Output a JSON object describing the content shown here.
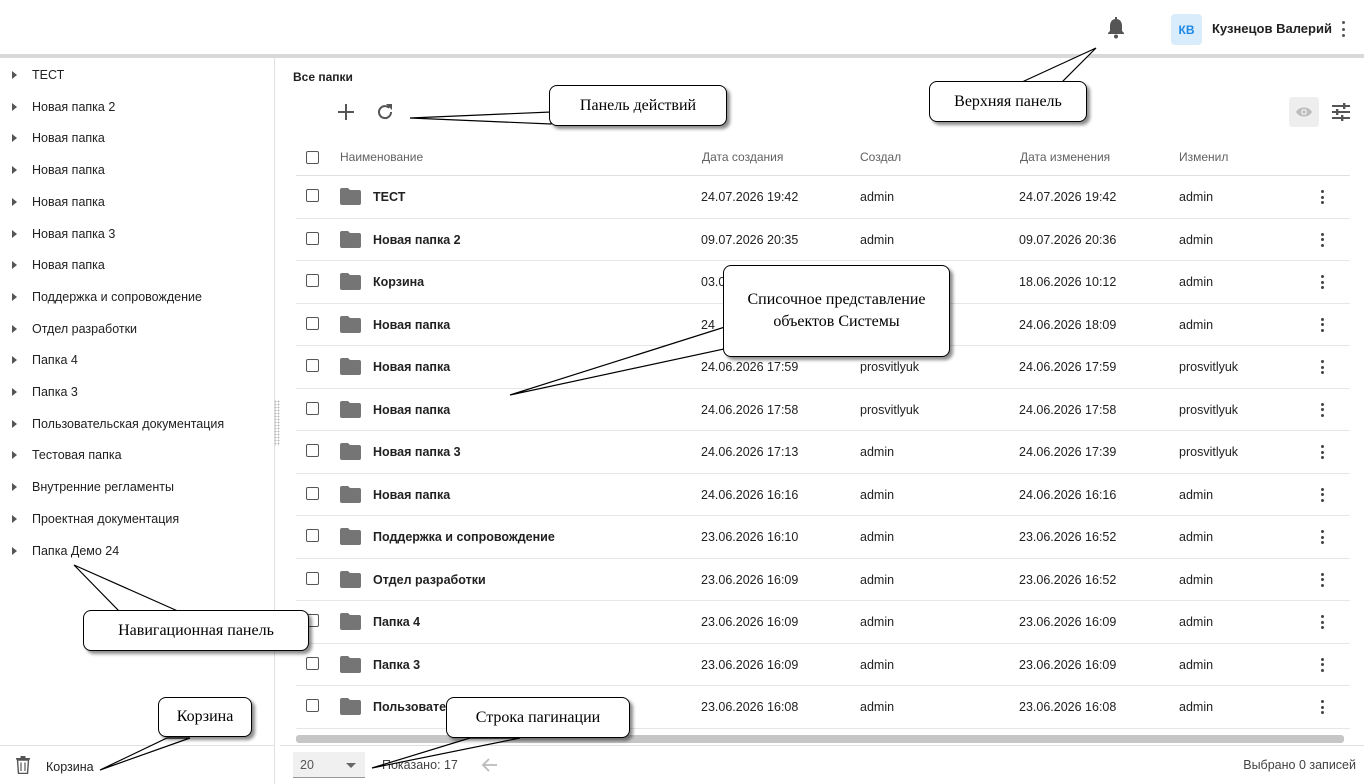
{
  "header": {
    "avatar_initials": "КВ",
    "user_name": "Кузнецов Валерий"
  },
  "sidebar": {
    "items": [
      {
        "label": "ТЕСТ"
      },
      {
        "label": "Новая папка 2"
      },
      {
        "label": "Новая папка"
      },
      {
        "label": "Новая папка"
      },
      {
        "label": "Новая папка"
      },
      {
        "label": "Новая папка 3"
      },
      {
        "label": "Новая папка"
      },
      {
        "label": "Поддержка и сопровождение"
      },
      {
        "label": "Отдел разработки"
      },
      {
        "label": "Папка 4"
      },
      {
        "label": "Папка 3"
      },
      {
        "label": "Пользовательская документация"
      },
      {
        "label": "Тестовая папка"
      },
      {
        "label": "Внутренние регламенты"
      },
      {
        "label": "Проектная документация"
      },
      {
        "label": "Папка Демо 24"
      }
    ],
    "trash_label": "Корзина"
  },
  "main": {
    "title": "Все папки",
    "columns": {
      "name": "Наименование",
      "created": "Дата создания",
      "created_by": "Создал",
      "modified": "Дата изменения",
      "modified_by": "Изменил"
    },
    "rows": [
      {
        "name": "ТЕСТ",
        "created": "24.07.2026 19:42",
        "created_by": "admin",
        "modified": "24.07.2026 19:42",
        "modified_by": "admin"
      },
      {
        "name": "Новая папка 2",
        "created": "09.07.2026 20:35",
        "created_by": "admin",
        "modified": "09.07.2026 20:36",
        "modified_by": "admin"
      },
      {
        "name": "Корзина",
        "created": "03.0",
        "created_by": "",
        "modified": "18.06.2026 10:12",
        "modified_by": "admin"
      },
      {
        "name": "Новая папка",
        "created": "24",
        "created_by": "",
        "modified": "24.06.2026 18:09",
        "modified_by": "admin"
      },
      {
        "name": "Новая папка",
        "created": "24.06.2026 17:59",
        "created_by": "prosvitlyuk",
        "modified": "24.06.2026 17:59",
        "modified_by": "prosvitlyuk"
      },
      {
        "name": "Новая папка",
        "created": "24.06.2026 17:58",
        "created_by": "prosvitlyuk",
        "modified": "24.06.2026 17:58",
        "modified_by": "prosvitlyuk"
      },
      {
        "name": "Новая папка 3",
        "created": "24.06.2026 17:13",
        "created_by": "admin",
        "modified": "24.06.2026 17:39",
        "modified_by": "prosvitlyuk"
      },
      {
        "name": "Новая папка",
        "created": "24.06.2026 16:16",
        "created_by": "admin",
        "modified": "24.06.2026 16:16",
        "modified_by": "admin"
      },
      {
        "name": "Поддержка и сопровождение",
        "created": "23.06.2026 16:10",
        "created_by": "admin",
        "modified": "23.06.2026 16:52",
        "modified_by": "admin"
      },
      {
        "name": "Отдел разработки",
        "created": "23.06.2026 16:09",
        "created_by": "admin",
        "modified": "23.06.2026 16:52",
        "modified_by": "admin"
      },
      {
        "name": "Папка 4",
        "created": "23.06.2026 16:09",
        "created_by": "admin",
        "modified": "23.06.2026 16:09",
        "modified_by": "admin"
      },
      {
        "name": "Папка 3",
        "created": "23.06.2026 16:09",
        "created_by": "admin",
        "modified": "23.06.2026 16:09",
        "modified_by": "admin"
      },
      {
        "name": "Пользовател",
        "created": "23.06.2026 16:08",
        "created_by": "admin",
        "modified": "23.06.2026 16:08",
        "modified_by": "admin"
      }
    ]
  },
  "footer": {
    "page_size": "20",
    "shown": "Показано: 17",
    "selected": "Выбрано 0 записей"
  },
  "callouts": {
    "top_panel": "Верхняя панель",
    "action_panel": "Панель действий",
    "list_view": "Списочное представление объектов Системы",
    "nav_panel": "Навигационная панель",
    "trash": "Корзина",
    "pagination": "Строка пагинации"
  },
  "icons": {
    "bell": "bell-icon",
    "add": "plus-icon",
    "refresh": "refresh-icon",
    "eye": "eye-icon",
    "tune": "tune-icon",
    "folder": "folder-icon",
    "trash": "trash-icon",
    "back": "arrow-left-icon"
  },
  "colors": {
    "avatar_bg": "#d9ecfb",
    "avatar_text": "#1e88e5",
    "folder": "#757575"
  }
}
